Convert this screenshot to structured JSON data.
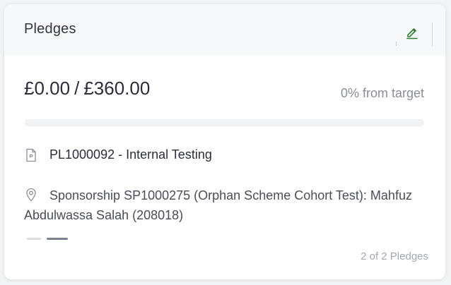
{
  "card": {
    "title": "Pledges",
    "edit_icon": "pencil-edit-icon",
    "accent_color": "#2e7d32"
  },
  "pledge": {
    "raised": "£0.00",
    "separator": "/",
    "target": "£360.00",
    "progress_label": "0% from target",
    "progress_percent": 0,
    "reference": "PL1000092 - Internal Testing",
    "reference_icon": "document-icon",
    "sponsorship": "Sponsorship SP1000275 (Orphan Scheme Cohort Test): Mahfuz Abdulwassa Salah (208018)",
    "sponsorship_icon": "location-pin-icon"
  },
  "pager": {
    "total_pages": 2,
    "active_page": 2,
    "counter": "2 of 2 Pledges"
  }
}
